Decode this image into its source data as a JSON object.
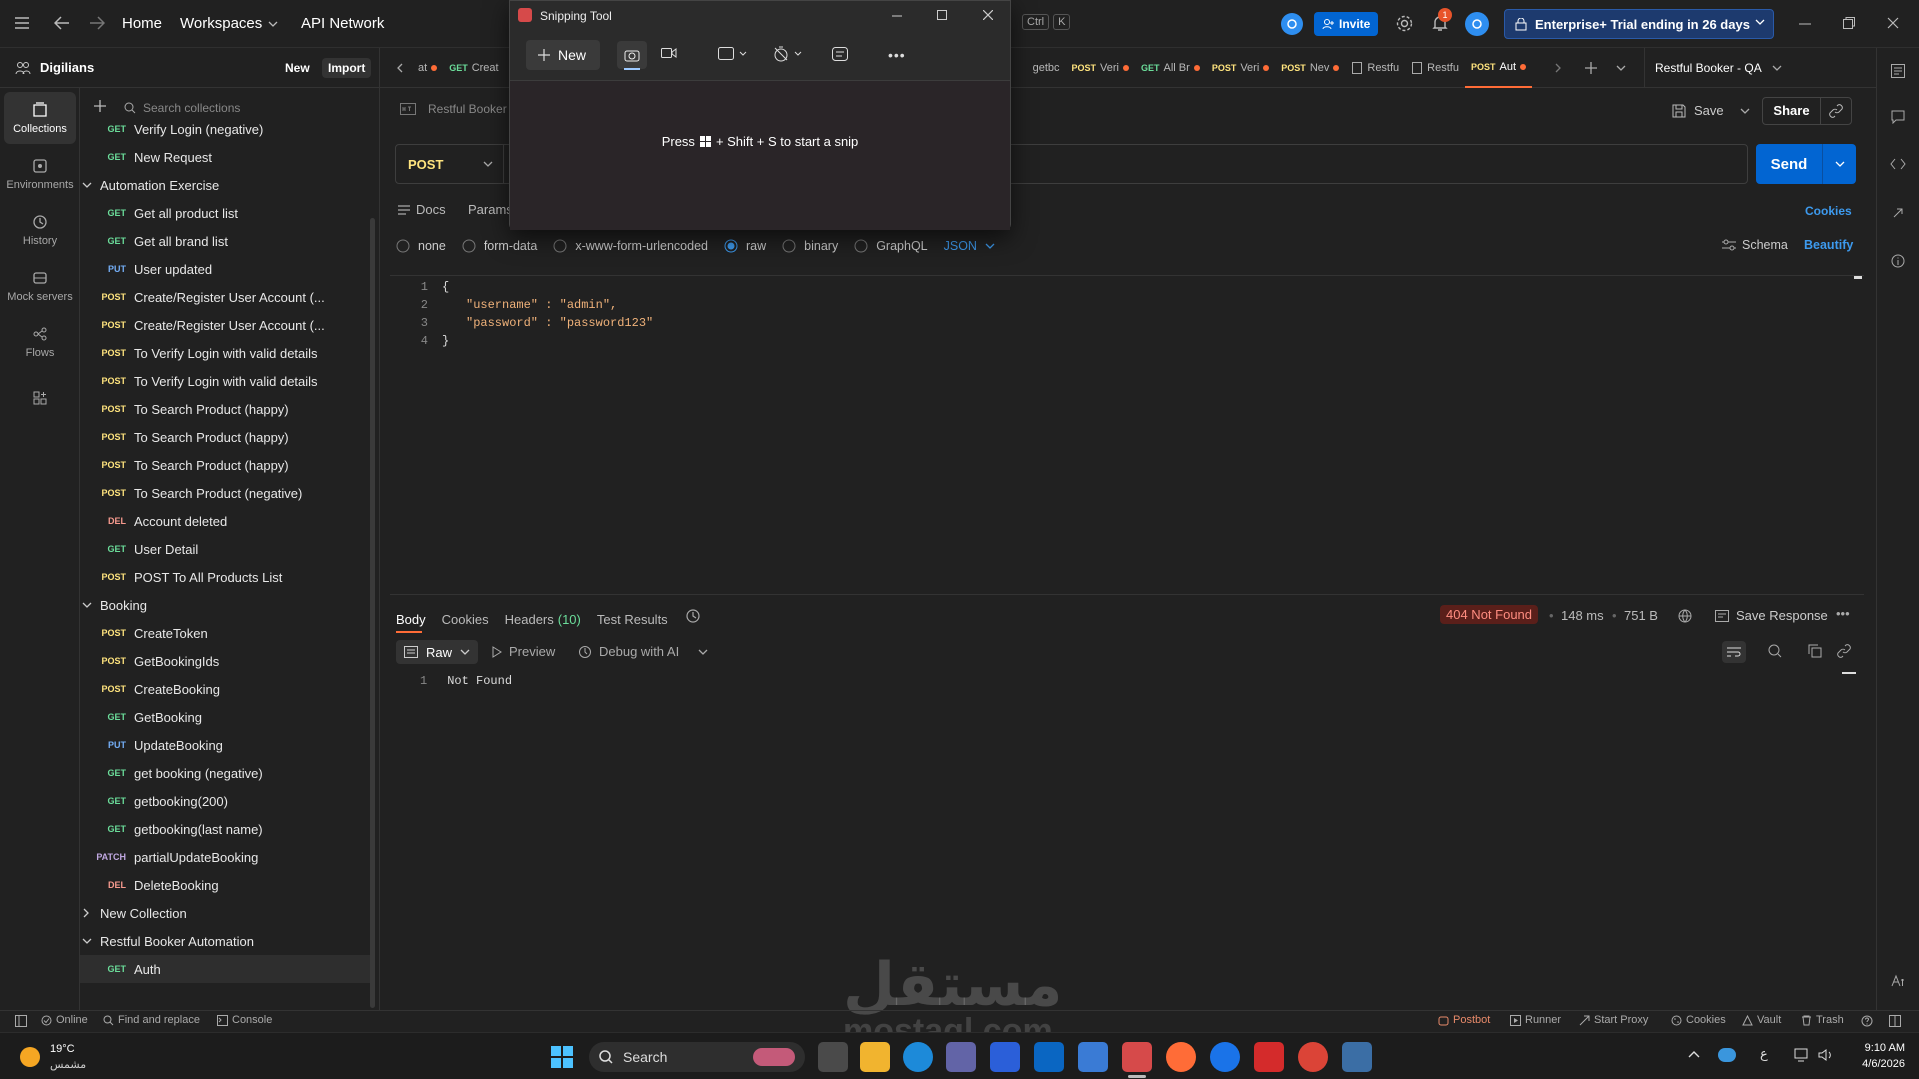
{
  "topbar": {
    "home": "Home",
    "workspaces": "Workspaces",
    "api_network": "API Network",
    "search_shortcut_ctrl": "Ctrl",
    "search_shortcut_key": "K",
    "invite": "Invite",
    "notification_count": "1",
    "trial": "Enterprise+ Trial ending in 26 days"
  },
  "workspace": {
    "name": "Digilians",
    "new": "New",
    "import": "Import",
    "search_placeholder": "Search collections"
  },
  "rail": [
    {
      "label": "Collections",
      "icon": "collections-icon"
    },
    {
      "label": "Environments",
      "icon": "environments-icon"
    },
    {
      "label": "History",
      "icon": "history-icon"
    },
    {
      "label": "Mock servers",
      "icon": "mock-servers-icon"
    },
    {
      "label": "Flows",
      "icon": "flows-icon"
    }
  ],
  "tree": {
    "top_items": [
      {
        "method": "GET",
        "label": "Verify Login (negative)"
      },
      {
        "method": "GET",
        "label": "New Request"
      }
    ],
    "automation_exercise": "Automation Exercise",
    "ae_items": [
      {
        "method": "GET",
        "label": "Get all product list"
      },
      {
        "method": "GET",
        "label": "Get all brand list"
      },
      {
        "method": "PUT",
        "label": "User updated"
      },
      {
        "method": "POST",
        "label": "Create/Register User Account (..."
      },
      {
        "method": "POST",
        "label": "Create/Register User Account (..."
      },
      {
        "method": "POST",
        "label": "To Verify Login with valid details"
      },
      {
        "method": "POST",
        "label": "To Verify Login with valid details"
      },
      {
        "method": "POST",
        "label": "To Search Product (happy)"
      },
      {
        "method": "POST",
        "label": "To Search Product (happy)"
      },
      {
        "method": "POST",
        "label": "To Search Product (happy)"
      },
      {
        "method": "POST",
        "label": "To Search Product (negative)"
      },
      {
        "method": "DEL",
        "label": "Account deleted"
      },
      {
        "method": "GET",
        "label": "User Detail"
      },
      {
        "method": "POST",
        "label": "POST To All Products List"
      }
    ],
    "booking": "Booking",
    "booking_items": [
      {
        "method": "POST",
        "label": "CreateToken"
      },
      {
        "method": "POST",
        "label": "GetBookingIds"
      },
      {
        "method": "POST",
        "label": "CreateBooking"
      },
      {
        "method": "GET",
        "label": "GetBooking"
      },
      {
        "method": "PUT",
        "label": "UpdateBooking"
      },
      {
        "method": "GET",
        "label": "get booking (negative)"
      },
      {
        "method": "GET",
        "label": "getbooking(200)"
      },
      {
        "method": "GET",
        "label": "getbooking(last name)"
      },
      {
        "method": "PATCH",
        "label": "partialUpdateBooking"
      },
      {
        "method": "DEL",
        "label": "DeleteBooking"
      }
    ],
    "new_collection": "New Collection",
    "restful": "Restful Booker Automation",
    "restful_items": [
      {
        "method": "GET",
        "label": "Auth"
      }
    ]
  },
  "tabs": {
    "left": [
      {
        "m": "",
        "t": "at",
        "dot": true
      },
      {
        "m": "GET",
        "t": "Creat",
        "dot": false
      }
    ],
    "right": [
      {
        "m": "",
        "t": "getbc",
        "dot": false
      },
      {
        "m": "POST",
        "t": "Veri",
        "dot": true
      },
      {
        "m": "GET",
        "t": "All Br",
        "dot": true
      },
      {
        "m": "POST",
        "t": "Veri",
        "dot": true
      },
      {
        "m": "POST",
        "t": "Nev",
        "dot": true
      },
      {
        "m": "",
        "t": "Restfu",
        "dot": false
      },
      {
        "m": "",
        "t": "Restfu",
        "dot": false
      },
      {
        "m": "POST",
        "t": "Aut",
        "dot": true
      }
    ],
    "env": "Restful Booker - QA"
  },
  "request": {
    "breadcrumb": "Restful Booker",
    "save": "Save",
    "share": "Share",
    "method": "POST",
    "send": "Send",
    "docs": "Docs",
    "params": "Params",
    "cookies": "Cookies",
    "body_types": [
      "none",
      "form-data",
      "x-www-form-urlencoded",
      "raw",
      "binary",
      "GraphQL"
    ],
    "selected_body": "raw",
    "format": "JSON",
    "schema": "Schema",
    "beautify": "Beautify",
    "code_lines": [
      "{",
      "\"username\" : \"admin\",",
      "\"password\" : \"password123\"",
      "}"
    ],
    "line_numbers": [
      "1",
      "2",
      "3",
      "4"
    ]
  },
  "response": {
    "tabs": [
      "Body",
      "Cookies",
      "Headers",
      "Test Results"
    ],
    "headers_count": "(10)",
    "status": "404 Not Found",
    "time": "148 ms",
    "size": "751 B",
    "save": "Save Response",
    "view": "Raw",
    "preview": "Preview",
    "debug": "Debug with AI",
    "line": "1",
    "text": "Not Found"
  },
  "statusbar": {
    "online": "Online",
    "find": "Find and replace",
    "console": "Console",
    "postbot": "Postbot",
    "runner": "Runner",
    "proxy": "Start Proxy",
    "cookies": "Cookies",
    "vault": "Vault",
    "trash": "Trash"
  },
  "snip": {
    "title": "Snipping Tool",
    "new": "New",
    "hint_pre": "Press",
    "hint_post": "+ Shift + S to start a snip"
  },
  "taskbar": {
    "temp": "19°C",
    "weather": "مشمس",
    "search": "Search",
    "time": "9:10 AM",
    "date": "4/6/2026",
    "lang": "ع"
  },
  "watermark": {
    "arabic": "مستقل",
    "latin": "mostaql.com"
  },
  "colors": {
    "accent": "#0265d2",
    "brand": "#ff6c37",
    "error": "#b3261e"
  }
}
